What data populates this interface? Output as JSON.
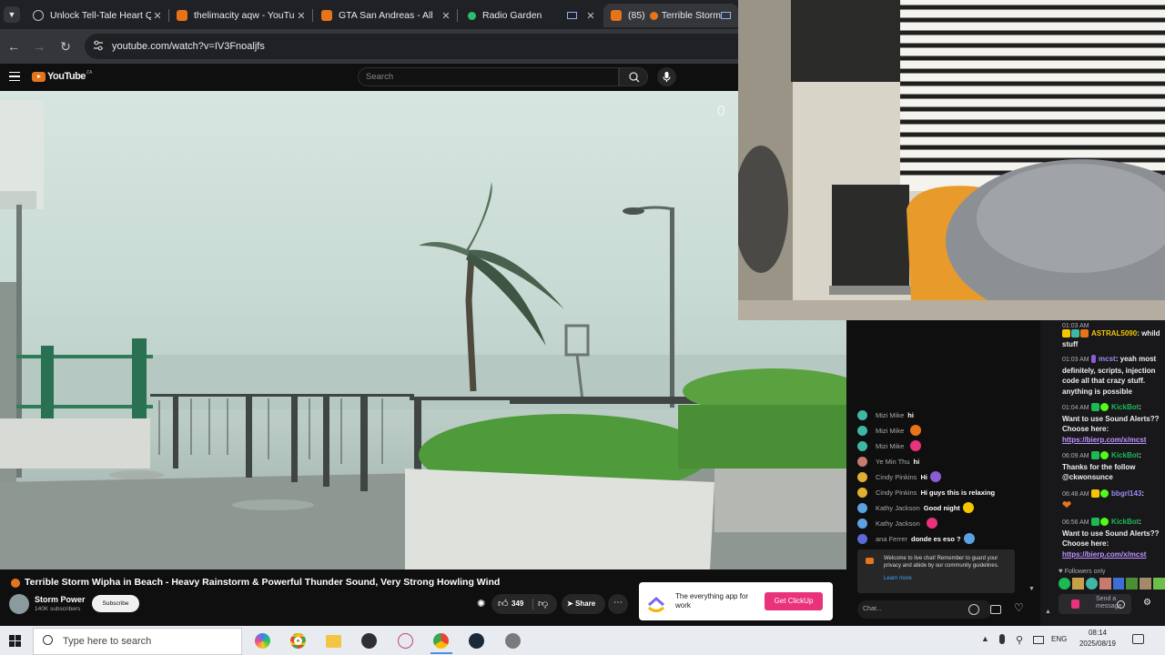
{
  "browser": {
    "tabs": [
      {
        "title": "Unlock Tell-Tale Heart Q",
        "favicon_color": "#202124",
        "active": false
      },
      {
        "title": "thelimacity aqw - YouTu",
        "favicon_color": "#e8741a",
        "active": false
      },
      {
        "title": "GTA San Andreas - All",
        "favicon_color": "#e8741a",
        "active": false
      },
      {
        "title": "Radio Garden",
        "favicon_color": "#2bbf6c",
        "active": false
      },
      {
        "title": "(85)",
        "title_rest": "Terrible Storm",
        "favicon_color": "#e8741a",
        "active": true
      }
    ],
    "url": "youtube.com/watch?v=IV3Fnoaljfs"
  },
  "youtube": {
    "logo": "YouTube",
    "region": "ZA",
    "search_placeholder": "Search",
    "video": {
      "watermark": "0",
      "title": "Terrible Storm Wipha in Beach - Heavy Rainstorm & Powerful Thunder Sound, Very Strong Howling Wind",
      "channel": "Storm Power",
      "subscribers": "140K subscribers",
      "subscribe_label": "Subscribe",
      "likes": "349",
      "share_label": "Share"
    },
    "ad": {
      "text": "The everything app for work",
      "cta": "Get ClickUp",
      "brand_color": "#e8327c"
    },
    "live_chat": {
      "messages": [
        {
          "author": "Mizi Mike",
          "text": "hi",
          "avatar_color": "#3fb7a5"
        },
        {
          "author": "Mizi Mike",
          "text": "",
          "emoji_color": "#e8741a",
          "avatar_color": "#3fb7a5"
        },
        {
          "author": "Mizi Mike",
          "text": "",
          "emoji_color": "#e8327c",
          "avatar_color": "#3fb7a5"
        },
        {
          "author": "Ye Min Thu",
          "text": "hi",
          "avatar_color": "#c77a6e"
        },
        {
          "author": "Cindy Pinkins",
          "text": "Hi",
          "emoji_color": "#8a5cd6",
          "avatar_color": "#e0b030"
        },
        {
          "author": "Cindy Pinkins",
          "text": "Hi guys this is relaxing",
          "avatar_color": "#e0b030"
        },
        {
          "author": "Kathy Jackson",
          "text": "Good night",
          "emoji_color": "#f6c700",
          "avatar_color": "#5ba3e0"
        },
        {
          "author": "Kathy Jackson",
          "text": "",
          "emoji_color": "#e8327c",
          "avatar_color": "#5ba3e0"
        },
        {
          "author": "ana Ferrer",
          "text": "donde es eso ?",
          "emoji_color": "#5ba3e0",
          "avatar_color": "#5b6ad6"
        }
      ],
      "welcome": "Welcome to live chat! Remember to guard your privacy and abide by our community guidelines.",
      "learn_more": "Learn more",
      "input_placeholder": "Chat..."
    }
  },
  "twitch_chat": {
    "messages": [
      {
        "time": "01:03 AM",
        "user": "",
        "text": "",
        "partial": true
      },
      {
        "time": "",
        "user": "ASTRAL5090",
        "text": "whild stuff"
      },
      {
        "time": "01:03 AM",
        "user": "mcst",
        "text": "yeah most definitely, scripts, injection code all that crazy stuff. anything is possible"
      },
      {
        "time": "01:04 AM",
        "user": "KickBot",
        "text": "Want to use Sound Alerts?? Choose here:",
        "link": "https://bierp.com/x/mcst"
      },
      {
        "time": "06:09 AM",
        "user": "KickBot",
        "text": "Thanks for the follow @ckwonsunce"
      },
      {
        "time": "06:48 AM",
        "user": "bbgrl143",
        "text": ""
      },
      {
        "time": "06:56 AM",
        "user": "KickBot",
        "text": "Want to use Sound Alerts?? Choose here:",
        "link": "https://bierp.com/x/mcst"
      }
    ],
    "followers_only": "Followers only",
    "send_placeholder": "Send a message"
  },
  "taskbar": {
    "search_placeholder": "Type here to search",
    "language": "ENG",
    "time": "08:14",
    "date": "2025/08/19"
  }
}
